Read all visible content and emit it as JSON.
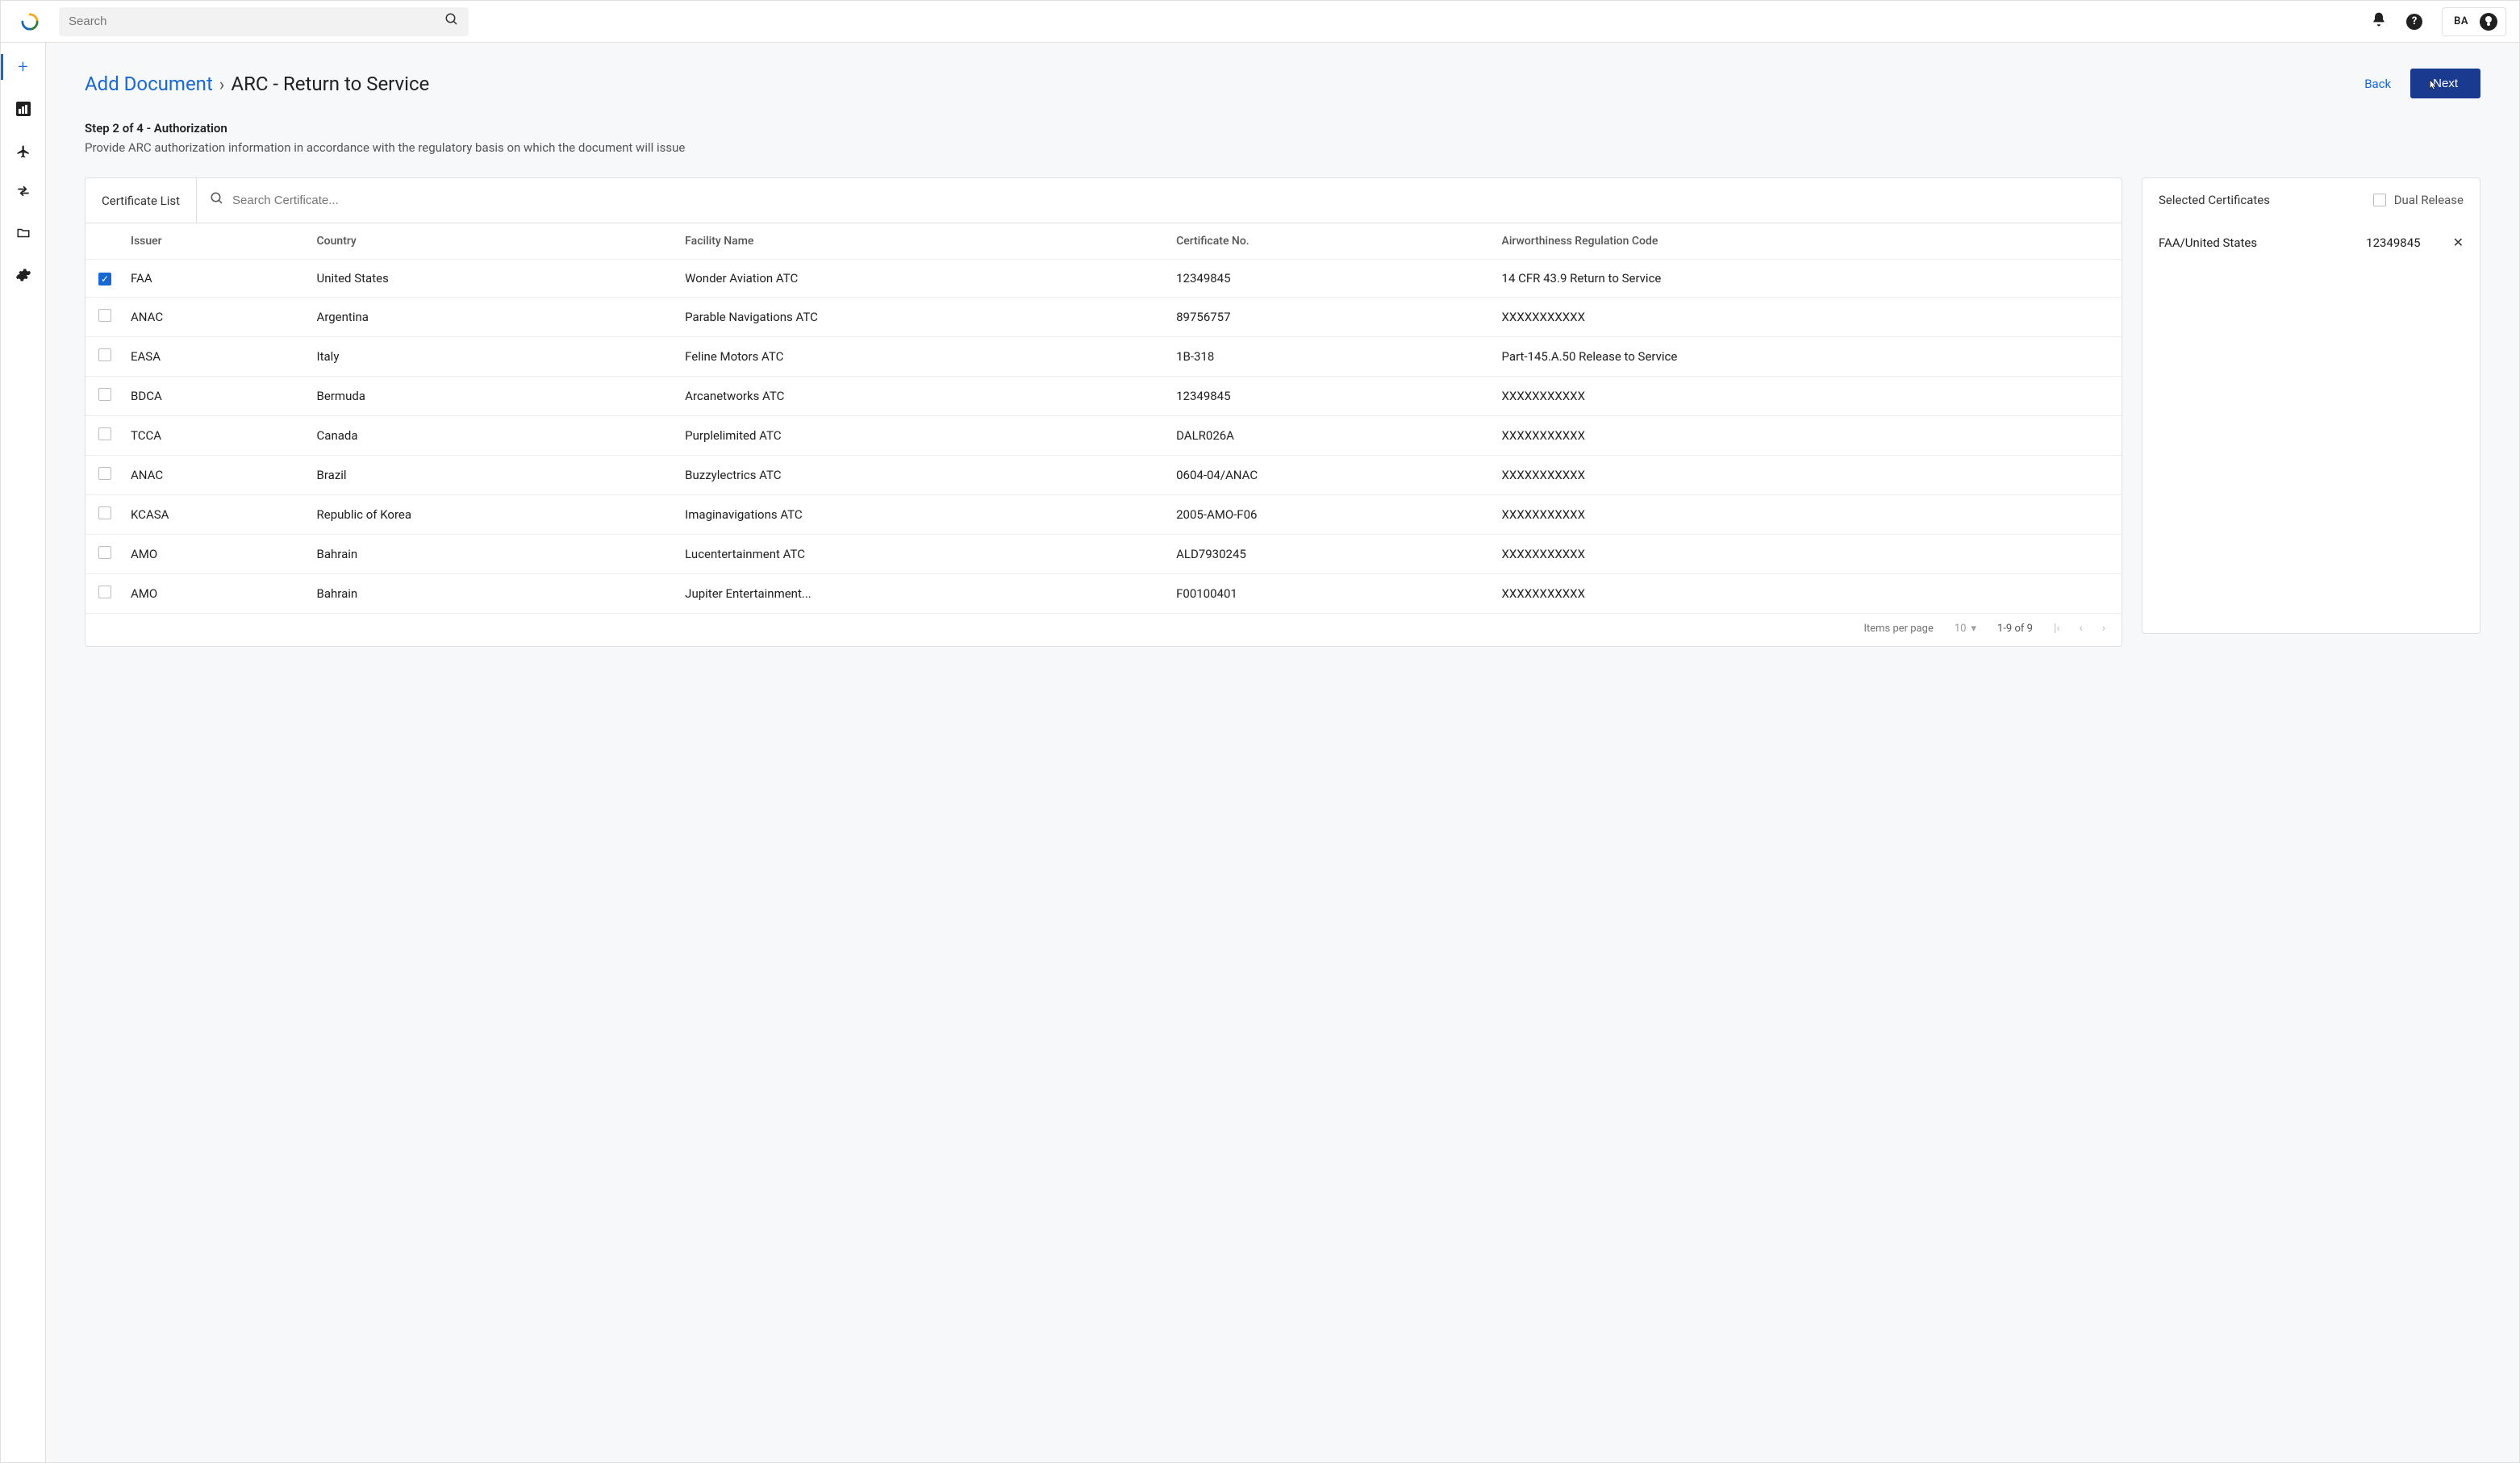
{
  "topbar": {
    "search_placeholder": "Search",
    "user_initials": "BA"
  },
  "breadcrumb": {
    "link": "Add Document",
    "separator": "›",
    "current": "ARC - Return to Service"
  },
  "actions": {
    "back_label": "Back",
    "next_label": "Next"
  },
  "step": {
    "title": "Step 2 of 4 - Authorization",
    "subtitle": "Provide ARC authorization information in accordance with the regulatory basis on which the document will issue"
  },
  "cert_panel": {
    "title": "Certificate List",
    "search_placeholder": "Search Certificate...",
    "columns": {
      "issuer": "Issuer",
      "country": "Country",
      "facility": "Facility Name",
      "certno": "Certificate No.",
      "arc": "Airworthiness Regulation Code"
    },
    "rows": [
      {
        "checked": true,
        "issuer": "FAA",
        "country": "United States",
        "facility": "Wonder Aviation ATC",
        "certno": "12349845",
        "arc": "14 CFR 43.9 Return to Service"
      },
      {
        "checked": false,
        "issuer": "ANAC",
        "country": "Argentina",
        "facility": "Parable Navigations ATC",
        "certno": "89756757",
        "arc": "XXXXXXXXXXX"
      },
      {
        "checked": false,
        "issuer": "EASA",
        "country": "Italy",
        "facility": "Feline Motors ATC",
        "certno": "1B-318",
        "arc": "Part-145.A.50 Release to Service"
      },
      {
        "checked": false,
        "issuer": "BDCA",
        "country": "Bermuda",
        "facility": "Arcanetworks ATC",
        "certno": "12349845",
        "arc": "XXXXXXXXXXX"
      },
      {
        "checked": false,
        "issuer": "TCCA",
        "country": "Canada",
        "facility": "Purplelimited ATC",
        "certno": "DALR026A",
        "arc": "XXXXXXXXXXX"
      },
      {
        "checked": false,
        "issuer": "ANAC",
        "country": "Brazil",
        "facility": "Buzzylectrics ATC",
        "certno": "0604-04/ANAC",
        "arc": "XXXXXXXXXXX"
      },
      {
        "checked": false,
        "issuer": "KCASA",
        "country": "Republic of Korea",
        "facility": "Imaginavigations ATC",
        "certno": "2005-AMO-F06",
        "arc": "XXXXXXXXXXX"
      },
      {
        "checked": false,
        "issuer": "AMO",
        "country": "Bahrain",
        "facility": "Lucentertainment ATC",
        "certno": "ALD7930245",
        "arc": "XXXXXXXXXXX"
      },
      {
        "checked": false,
        "issuer": "AMO",
        "country": "Bahrain",
        "facility": "Jupiter Entertainment...",
        "certno": "F00100401",
        "arc": "XXXXXXXXXXX"
      }
    ]
  },
  "pagination": {
    "items_per_page_label": "Items per page",
    "items_per_page_value": "10",
    "range": "1-9 of 9"
  },
  "selected_panel": {
    "title": "Selected Certificates",
    "dual_release_label": "Dual Release",
    "dual_release_checked": false,
    "items": [
      {
        "issuer_country": "FAA/United States",
        "certno": "12349845"
      }
    ]
  }
}
